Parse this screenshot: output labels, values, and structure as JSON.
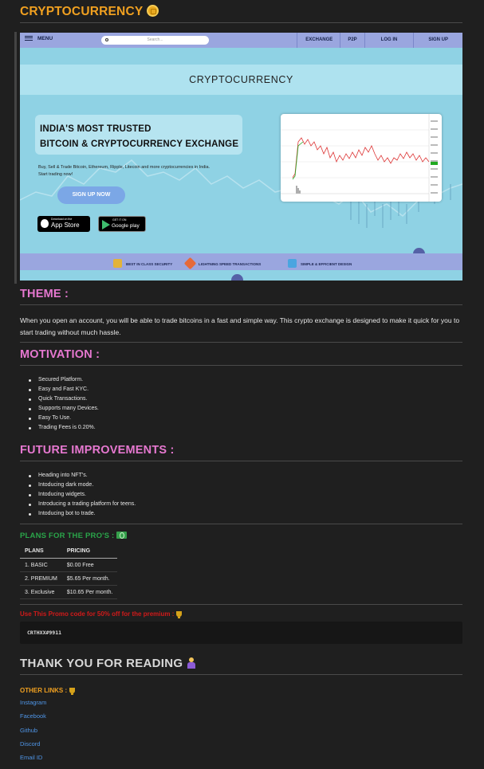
{
  "title": "CRYPTOCURRENCY",
  "title_icon": "coin-icon",
  "banner": {
    "nav": {
      "menu": "MENU",
      "search_placeholder": "Search...",
      "links": [
        "EXCHANGE",
        "P2P",
        "LOG IN",
        "SIGN UP"
      ]
    },
    "title": "CRYPTOCURRENCY",
    "headline_1": "INDIA'S MOST TRUSTED",
    "headline_2": "BITCOIN & CRYPTOCURRENCY EXCHANGE",
    "subtext_1": "Buy, Sell & Trade Bitcoin, Ethereum, Ripple, Litecoin and more cryptocurrencies in India.",
    "subtext_2": "Start trading now!",
    "signup": "SIGN UP NOW",
    "appstore_small": "Download on the",
    "appstore_big": "App Store",
    "googleplay_small": "GET IT ON",
    "googleplay_big": "Google play",
    "features": [
      "BEST IN CLASS SECURITY",
      "LIGHTNING SPEED TRANSACTIONS",
      "SIMPLE & EFFICIENT DESIGN"
    ]
  },
  "theme": {
    "heading": "THEME :",
    "text": "When you open an account, you will be able to trade bitcoins in a fast and simple way. This crypto exchange is designed to make it quick for you to start trading without much hassle."
  },
  "motivation": {
    "heading": "MOTIVATION :",
    "items": [
      "Secured Platform.",
      "Easy and Fast KYC.",
      "Quick Transactions.",
      "Supports many Devices.",
      "Easy To Use.",
      "Trading Fees is 0.20%."
    ]
  },
  "future": {
    "heading": "FUTURE IMPROVEMENTS :",
    "items": [
      "Heading into NFT's.",
      "Intoducing dark mode.",
      "Intoducing widgets.",
      "Introducing a trading platform for teens.",
      "Intoducing bot to trade."
    ]
  },
  "plans": {
    "heading": "PLANS FOR THE PRO'S :",
    "headers": [
      "PLANS",
      "PRICING"
    ],
    "rows": [
      [
        "1. BASIC",
        "$0.00 Free"
      ],
      [
        "2. PREMIUM",
        "$5.65 Per month."
      ],
      [
        "3. Exclusive",
        "$10.65 Per month."
      ]
    ]
  },
  "promo": {
    "text": "Use This Promo code for 50% off for the premium :",
    "code": "CRTHXX#9911"
  },
  "thanks": "THANK YOU FOR READING",
  "other_links": {
    "heading": "OTHER LINKS :",
    "links": [
      "Instagram",
      "Facebook",
      "Github",
      "Discord",
      "Email ID"
    ]
  },
  "colors": {
    "background": "#1f1f1f",
    "title": "#f0a020",
    "section_heading": "#e678d0",
    "plans_heading": "#2aa54a",
    "promo": "#d11a1a",
    "link": "#4f95e6"
  }
}
